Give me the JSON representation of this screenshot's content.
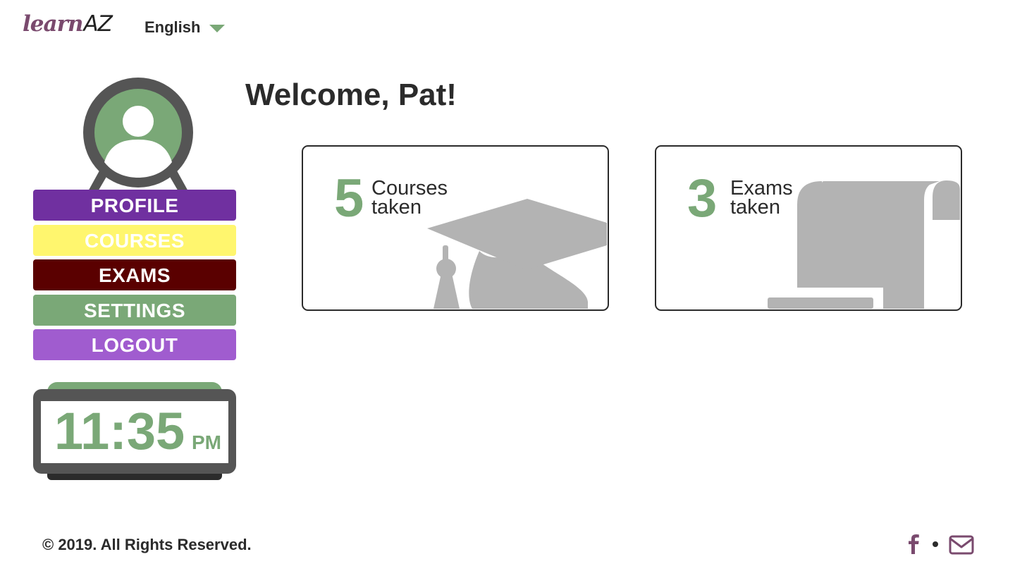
{
  "header": {
    "logo_learn": "learn",
    "logo_az": "AZ",
    "language": "English"
  },
  "nav": {
    "profile": "PROFILE",
    "courses": "COURSES",
    "exams": "EXAMS",
    "settings": "SETTINGS",
    "logout": "LOGOUT"
  },
  "clock": {
    "time": "11:35",
    "ampm": "PM"
  },
  "main": {
    "welcome": "Welcome, Pat!",
    "cards": [
      {
        "count": "5",
        "label_line1": "Courses",
        "label_line2": "taken",
        "icon": "graduation-cap-icon"
      },
      {
        "count": "3",
        "label_line1": "Exams",
        "label_line2": "taken",
        "icon": "scroll-icon"
      }
    ]
  },
  "footer": {
    "copyright": "© 2019. All Rights Reserved.",
    "links": [
      "facebook-icon",
      "email-icon"
    ]
  },
  "colors": {
    "accent_green": "#7aa877",
    "profile": "#7030a0",
    "courses": "#fff66e",
    "exams": "#5a0000",
    "settings": "#7aa877",
    "logout": "#a05ccf",
    "brand_purple": "#7a4a6e"
  }
}
